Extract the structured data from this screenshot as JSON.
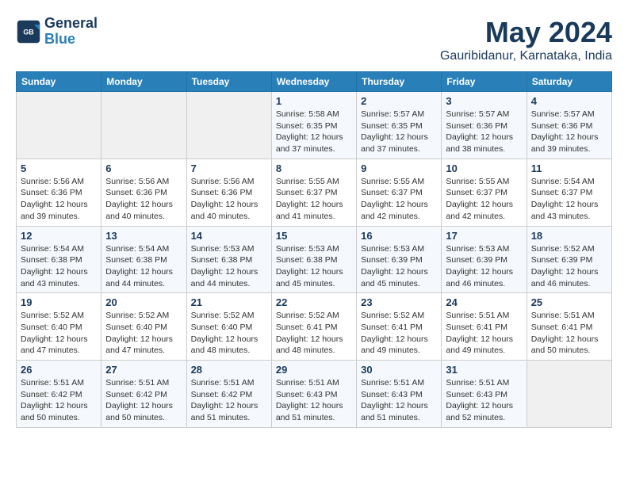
{
  "logo": {
    "line1": "General",
    "line2": "Blue"
  },
  "title": "May 2024",
  "subtitle": "Gauribidanur, Karnataka, India",
  "weekdays": [
    "Sunday",
    "Monday",
    "Tuesday",
    "Wednesday",
    "Thursday",
    "Friday",
    "Saturday"
  ],
  "weeks": [
    [
      {
        "day": "",
        "info": ""
      },
      {
        "day": "",
        "info": ""
      },
      {
        "day": "",
        "info": ""
      },
      {
        "day": "1",
        "info": "Sunrise: 5:58 AM\nSunset: 6:35 PM\nDaylight: 12 hours\nand 37 minutes."
      },
      {
        "day": "2",
        "info": "Sunrise: 5:57 AM\nSunset: 6:35 PM\nDaylight: 12 hours\nand 37 minutes."
      },
      {
        "day": "3",
        "info": "Sunrise: 5:57 AM\nSunset: 6:36 PM\nDaylight: 12 hours\nand 38 minutes."
      },
      {
        "day": "4",
        "info": "Sunrise: 5:57 AM\nSunset: 6:36 PM\nDaylight: 12 hours\nand 39 minutes."
      }
    ],
    [
      {
        "day": "5",
        "info": "Sunrise: 5:56 AM\nSunset: 6:36 PM\nDaylight: 12 hours\nand 39 minutes."
      },
      {
        "day": "6",
        "info": "Sunrise: 5:56 AM\nSunset: 6:36 PM\nDaylight: 12 hours\nand 40 minutes."
      },
      {
        "day": "7",
        "info": "Sunrise: 5:56 AM\nSunset: 6:36 PM\nDaylight: 12 hours\nand 40 minutes."
      },
      {
        "day": "8",
        "info": "Sunrise: 5:55 AM\nSunset: 6:37 PM\nDaylight: 12 hours\nand 41 minutes."
      },
      {
        "day": "9",
        "info": "Sunrise: 5:55 AM\nSunset: 6:37 PM\nDaylight: 12 hours\nand 42 minutes."
      },
      {
        "day": "10",
        "info": "Sunrise: 5:55 AM\nSunset: 6:37 PM\nDaylight: 12 hours\nand 42 minutes."
      },
      {
        "day": "11",
        "info": "Sunrise: 5:54 AM\nSunset: 6:37 PM\nDaylight: 12 hours\nand 43 minutes."
      }
    ],
    [
      {
        "day": "12",
        "info": "Sunrise: 5:54 AM\nSunset: 6:38 PM\nDaylight: 12 hours\nand 43 minutes."
      },
      {
        "day": "13",
        "info": "Sunrise: 5:54 AM\nSunset: 6:38 PM\nDaylight: 12 hours\nand 44 minutes."
      },
      {
        "day": "14",
        "info": "Sunrise: 5:53 AM\nSunset: 6:38 PM\nDaylight: 12 hours\nand 44 minutes."
      },
      {
        "day": "15",
        "info": "Sunrise: 5:53 AM\nSunset: 6:38 PM\nDaylight: 12 hours\nand 45 minutes."
      },
      {
        "day": "16",
        "info": "Sunrise: 5:53 AM\nSunset: 6:39 PM\nDaylight: 12 hours\nand 45 minutes."
      },
      {
        "day": "17",
        "info": "Sunrise: 5:53 AM\nSunset: 6:39 PM\nDaylight: 12 hours\nand 46 minutes."
      },
      {
        "day": "18",
        "info": "Sunrise: 5:52 AM\nSunset: 6:39 PM\nDaylight: 12 hours\nand 46 minutes."
      }
    ],
    [
      {
        "day": "19",
        "info": "Sunrise: 5:52 AM\nSunset: 6:40 PM\nDaylight: 12 hours\nand 47 minutes."
      },
      {
        "day": "20",
        "info": "Sunrise: 5:52 AM\nSunset: 6:40 PM\nDaylight: 12 hours\nand 47 minutes."
      },
      {
        "day": "21",
        "info": "Sunrise: 5:52 AM\nSunset: 6:40 PM\nDaylight: 12 hours\nand 48 minutes."
      },
      {
        "day": "22",
        "info": "Sunrise: 5:52 AM\nSunset: 6:41 PM\nDaylight: 12 hours\nand 48 minutes."
      },
      {
        "day": "23",
        "info": "Sunrise: 5:52 AM\nSunset: 6:41 PM\nDaylight: 12 hours\nand 49 minutes."
      },
      {
        "day": "24",
        "info": "Sunrise: 5:51 AM\nSunset: 6:41 PM\nDaylight: 12 hours\nand 49 minutes."
      },
      {
        "day": "25",
        "info": "Sunrise: 5:51 AM\nSunset: 6:41 PM\nDaylight: 12 hours\nand 50 minutes."
      }
    ],
    [
      {
        "day": "26",
        "info": "Sunrise: 5:51 AM\nSunset: 6:42 PM\nDaylight: 12 hours\nand 50 minutes."
      },
      {
        "day": "27",
        "info": "Sunrise: 5:51 AM\nSunset: 6:42 PM\nDaylight: 12 hours\nand 50 minutes."
      },
      {
        "day": "28",
        "info": "Sunrise: 5:51 AM\nSunset: 6:42 PM\nDaylight: 12 hours\nand 51 minutes."
      },
      {
        "day": "29",
        "info": "Sunrise: 5:51 AM\nSunset: 6:43 PM\nDaylight: 12 hours\nand 51 minutes."
      },
      {
        "day": "30",
        "info": "Sunrise: 5:51 AM\nSunset: 6:43 PM\nDaylight: 12 hours\nand 51 minutes."
      },
      {
        "day": "31",
        "info": "Sunrise: 5:51 AM\nSunset: 6:43 PM\nDaylight: 12 hours\nand 52 minutes."
      },
      {
        "day": "",
        "info": ""
      }
    ]
  ]
}
